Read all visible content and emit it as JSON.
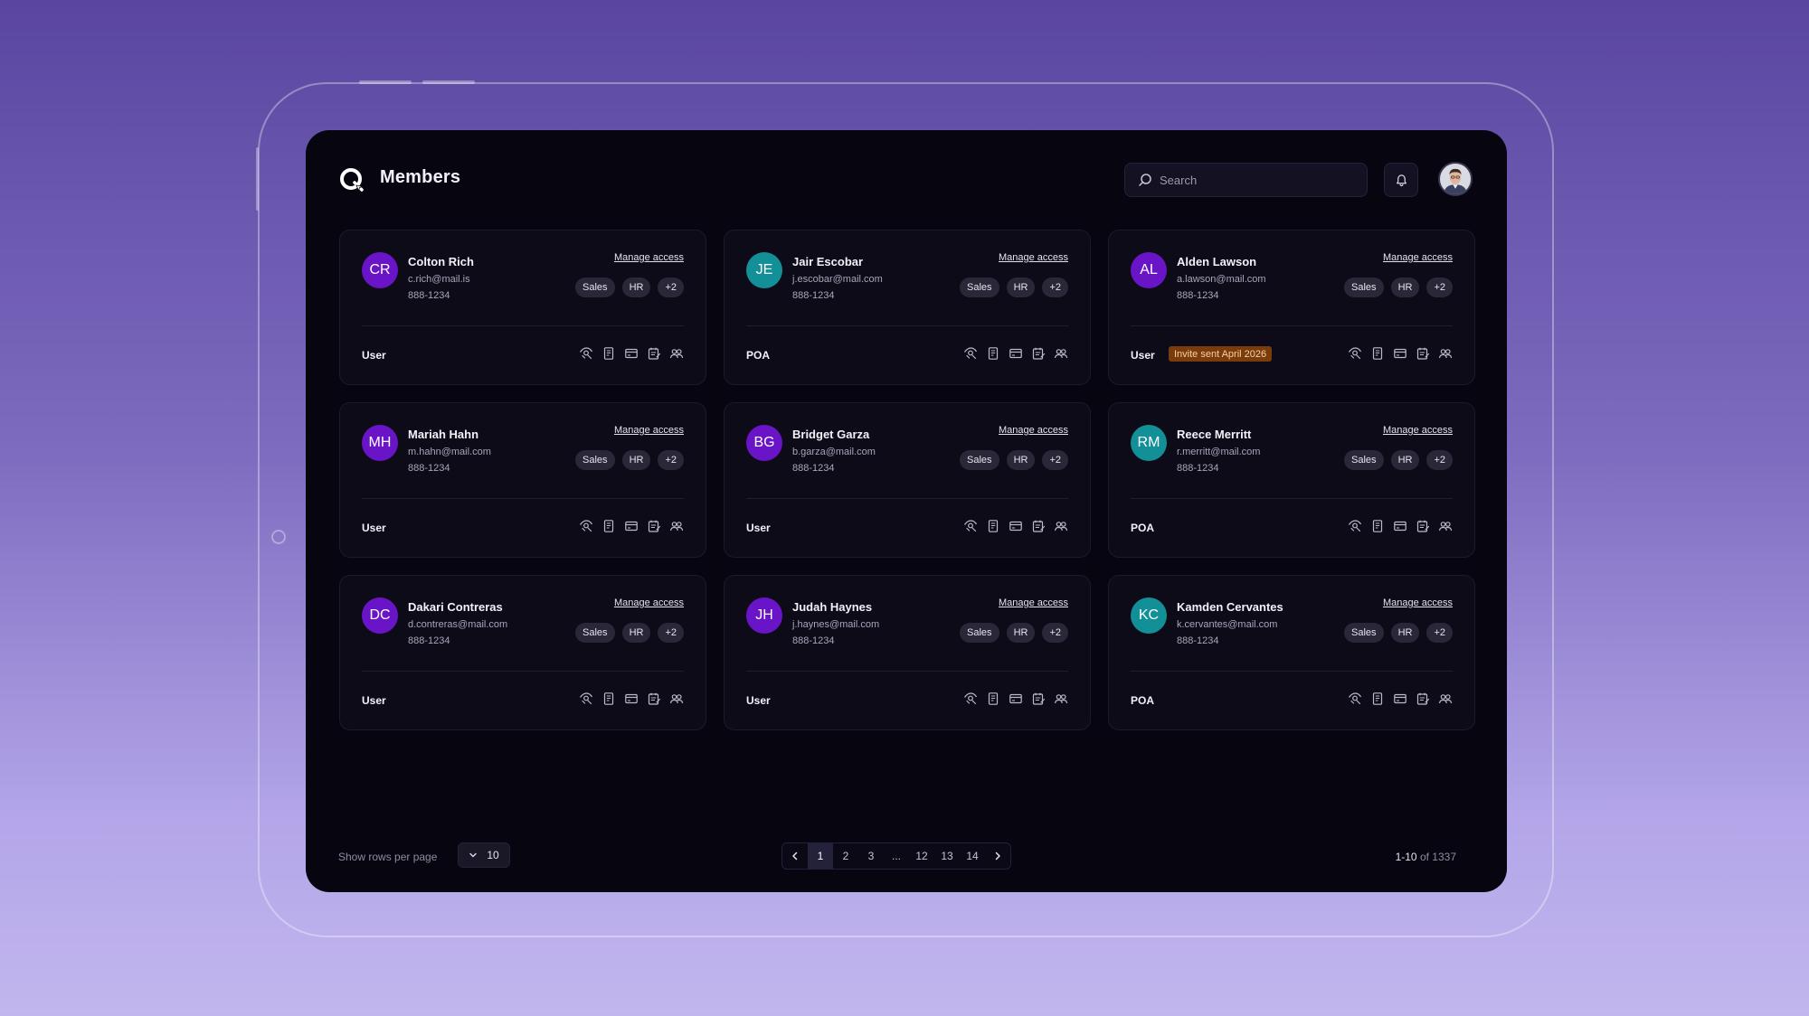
{
  "header": {
    "title": "Members",
    "search_placeholder": "Search"
  },
  "colors": {
    "purple_avatar": "#6a14c7",
    "teal_avatar": "#138f98",
    "invite_badge": "#7a3c0a",
    "background_top": "#5a46a0",
    "background_bottom": "#c2b6ee"
  },
  "card_labels": {
    "manage_access": "Manage access",
    "tag_sales": "Sales",
    "tag_hr": "HR",
    "tag_more": "+2"
  },
  "action_icons": [
    "view-icon",
    "document-icon",
    "card-icon",
    "notes-icon",
    "users-icon"
  ],
  "members": [
    {
      "initials": "CR",
      "name": "Colton Rich",
      "email": "c.rich@mail.is",
      "phone": "888-1234",
      "role": "User",
      "avatar_color": "#6a14c7",
      "invite": ""
    },
    {
      "initials": "JE",
      "name": "Jair Escobar",
      "email": "j.escobar@mail.com",
      "phone": "888-1234",
      "role": "POA",
      "avatar_color": "#138f98",
      "invite": ""
    },
    {
      "initials": "AL",
      "name": "Alden Lawson",
      "email": "a.lawson@mail.com",
      "phone": "888-1234",
      "role": "User",
      "avatar_color": "#6a14c7",
      "invite": "Invite sent April 2026"
    },
    {
      "initials": "MH",
      "name": "Mariah Hahn",
      "email": "m.hahn@mail.com",
      "phone": "888-1234",
      "role": "User",
      "avatar_color": "#6a14c7",
      "invite": ""
    },
    {
      "initials": "BG",
      "name": "Bridget Garza",
      "email": "b.garza@mail.com",
      "phone": "888-1234",
      "role": "User",
      "avatar_color": "#6a14c7",
      "invite": ""
    },
    {
      "initials": "RM",
      "name": "Reece Merritt",
      "email": "r.merritt@mail.com",
      "phone": "888-1234",
      "role": "POA",
      "avatar_color": "#138f98",
      "invite": ""
    },
    {
      "initials": "DC",
      "name": "Dakari Contreras",
      "email": "d.contreras@mail.com",
      "phone": "888-1234",
      "role": "User",
      "avatar_color": "#6a14c7",
      "invite": ""
    },
    {
      "initials": "JH",
      "name": "Judah Haynes",
      "email": "j.haynes@mail.com",
      "phone": "888-1234",
      "role": "User",
      "avatar_color": "#6a14c7",
      "invite": ""
    },
    {
      "initials": "KC",
      "name": "Kamden Cervantes",
      "email": "k.cervantes@mail.com",
      "phone": "888-1234",
      "role": "POA",
      "avatar_color": "#138f98",
      "invite": ""
    }
  ],
  "footer": {
    "rows_label": "Show rows per page",
    "rows_value": "10",
    "pages": [
      "1",
      "2",
      "3",
      "...",
      "12",
      "13",
      "14"
    ],
    "current_page": "1",
    "range": "1-10",
    "of_label": "of",
    "total": "1337"
  }
}
